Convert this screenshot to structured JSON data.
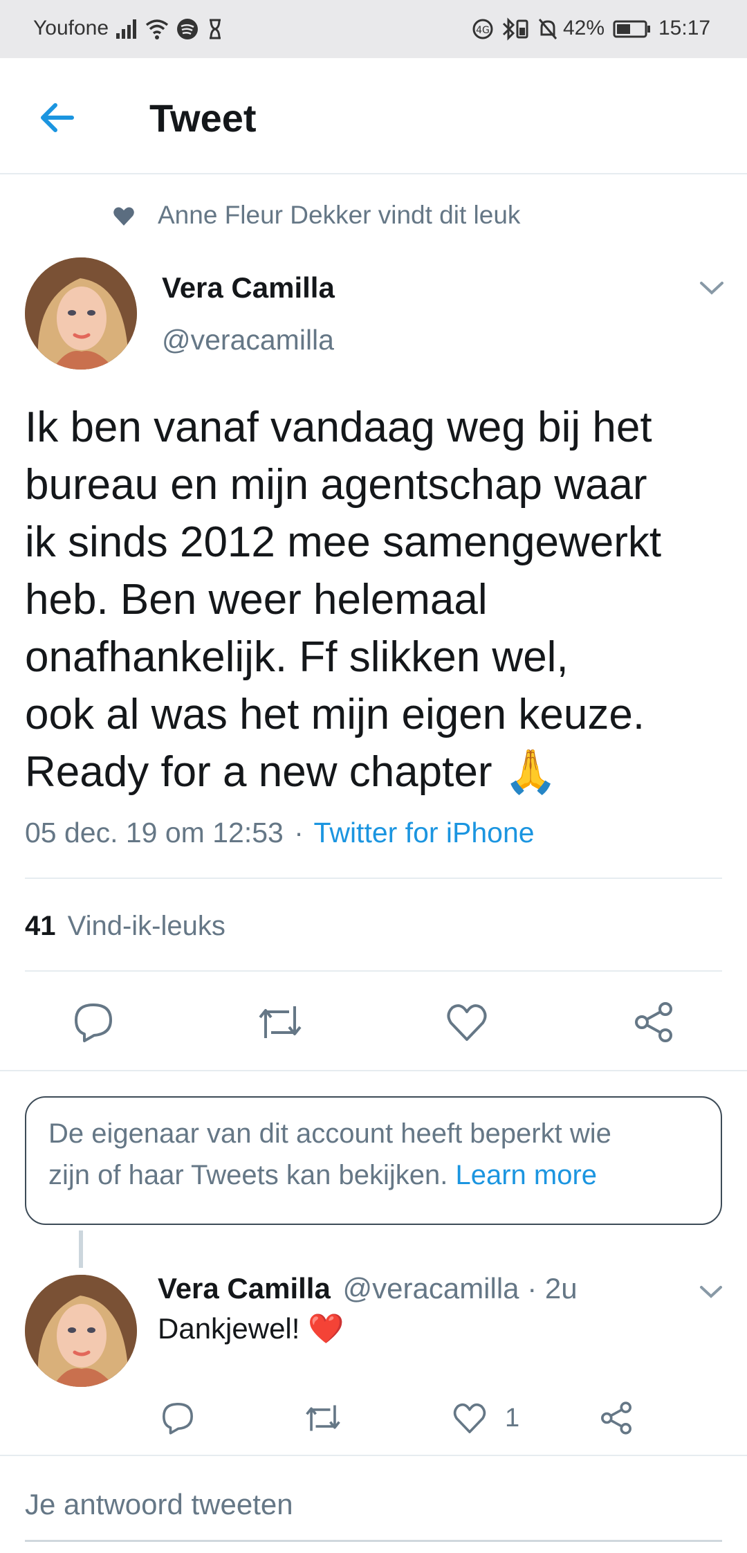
{
  "status_bar": {
    "carrier": "Youfone",
    "battery": "42%",
    "time": "15:17"
  },
  "header": {
    "title": "Tweet"
  },
  "tweet": {
    "social_context": "Anne Fleur Dekker vindt dit leuk",
    "author_name": "Vera Camilla",
    "author_handle": "@veracamilla",
    "text_lines": [
      "Ik ben vanaf vandaag weg bij het",
      "bureau en mijn agentschap waar",
      "ik sinds 2012 mee samengewerkt",
      "heb. Ben weer helemaal",
      "onafhankelijk. Ff slikken wel,",
      "ook al was het mijn eigen keuze.",
      "Ready for a new chapter 🙏"
    ],
    "timestamp": "05 dec. 19 om 12:53",
    "separator": "·",
    "source": "Twitter for iPhone",
    "likes_count": "41",
    "likes_label": "Vind-ik-leuks"
  },
  "notice": {
    "line1": "De eigenaar van dit account heeft beperkt wie",
    "line2": "zijn of haar Tweets kan bekijken.",
    "link": "Learn more"
  },
  "reply": {
    "author_name": "Vera Camilla",
    "meta": "@veracamilla · 2u",
    "text": "Dankjewel! ❤️",
    "like_count": "1"
  },
  "compose": {
    "placeholder": "Je antwoord tweeten"
  }
}
